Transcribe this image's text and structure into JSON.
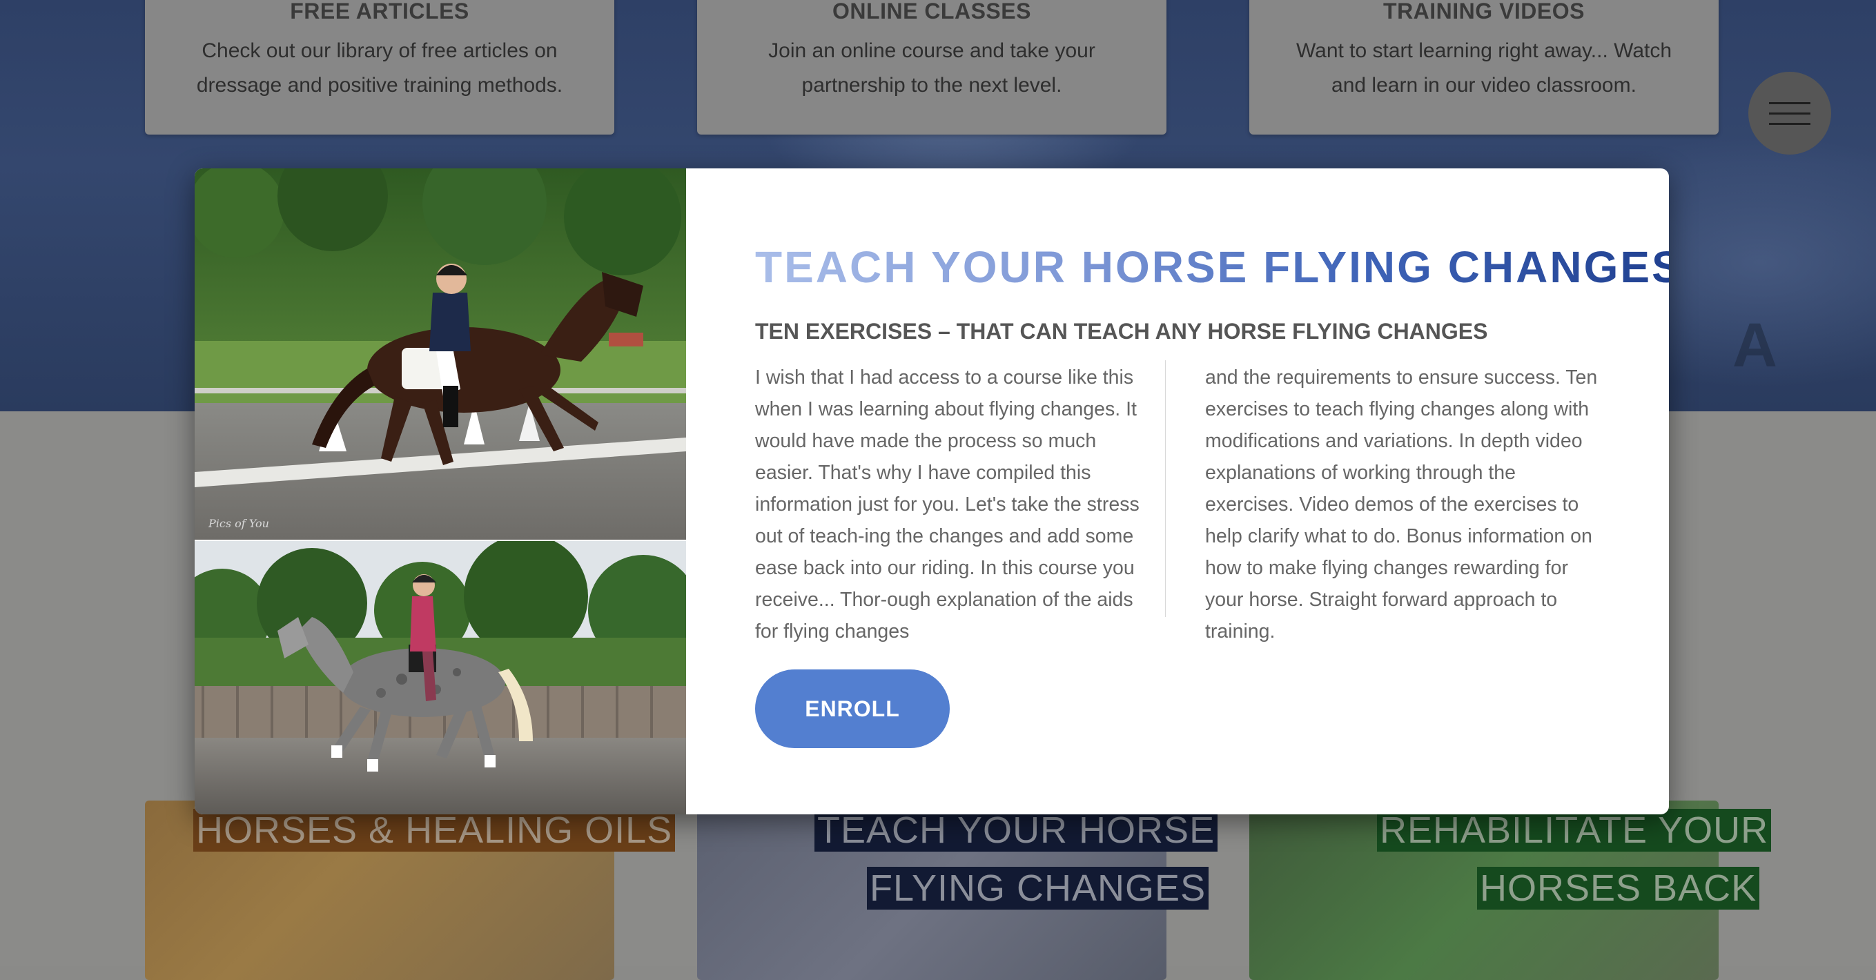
{
  "background": {
    "features": [
      {
        "title": "FREE ARTICLES",
        "text": "Check out our library of free articles on dressage and positive training methods."
      },
      {
        "title": "ONLINE CLASSES",
        "text": "Join an online course and take your partnership to the next level."
      },
      {
        "title": "TRAINING VIDEOS",
        "text": "Want to start learning right away... Watch and learn in our video classroom."
      }
    ],
    "courses": {
      "one": "HORSES & HEALING OILS",
      "two_line1": "TEACH YOUR HORSE",
      "two_line2": "FLYING CHANGES",
      "three_line1": "REHABILITATE YOUR",
      "three_line2": "HORSES BACK"
    },
    "hero_letter": "A"
  },
  "modal": {
    "title": "TEACH YOUR HORSE FLYING CHANGES",
    "subtitle": "TEN EXERCISES – THAT CAN TEACH ANY HORSE FLYING CHANGES",
    "column_1": "I wish that I had access to a course like this when I was learning about flying changes. It would have made the process so much easier. That's why I have compiled this information just for you. Let's take the stress out of teach-ing the changes and add some ease back into our riding. In this course you receive... Thor-ough explanation of the aids for flying changes",
    "column_2": "and the requirements to ensure success. Ten exercises to teach flying changes along with modifications and variations. In depth video explanations of working through the exercises. Video demos of the exercises to help clarify what to do. Bonus information on how to make flying changes rewarding for your horse. Straight forward approach to training.",
    "enroll_label": "ENROLL"
  },
  "colors": {
    "accent": "#537fd0",
    "title_dark": "#1f3f8f",
    "title_light": "#a9bde9"
  },
  "icons": {
    "menu": "hamburger-menu-icon"
  }
}
